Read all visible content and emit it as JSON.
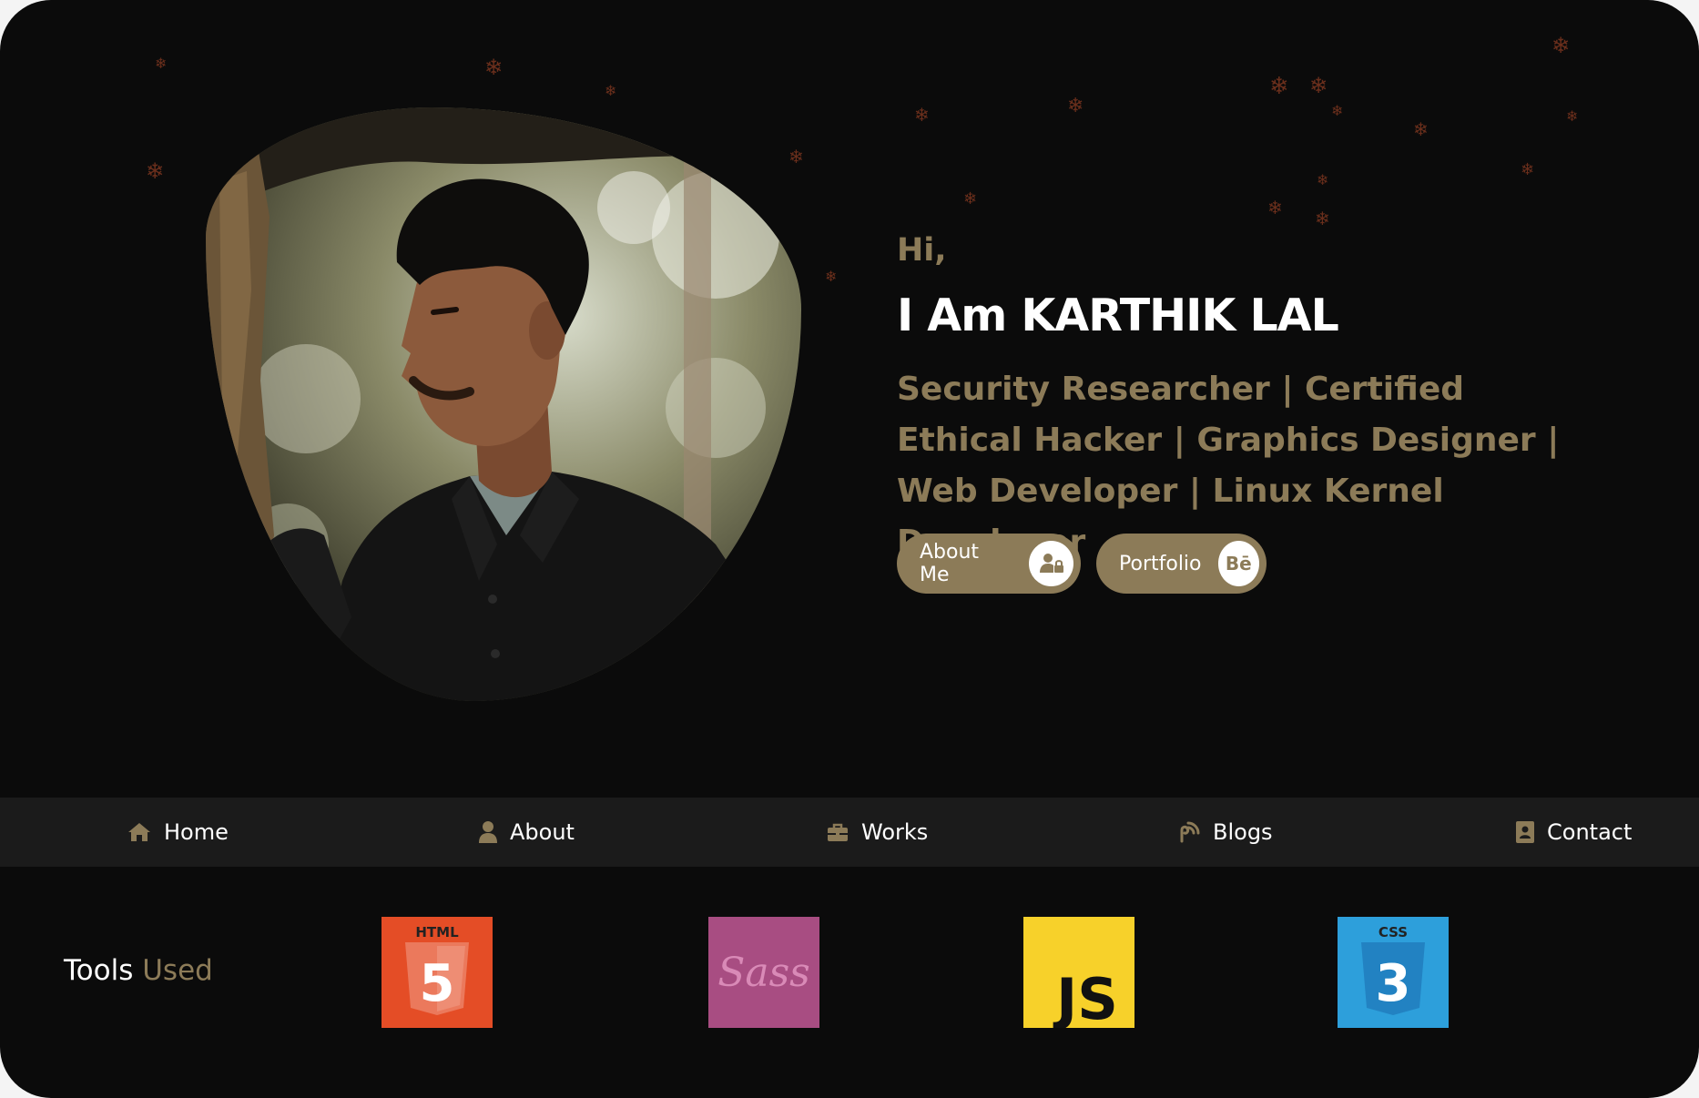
{
  "hero": {
    "greeting": "Hi,",
    "name": "I Am KARTHIK LAL",
    "roles": "Security Researcher | Certified Ethical Hacker | Graphics Designer | Web Developer | Linux Kernel Developer",
    "buttons": [
      {
        "label": "About Me",
        "icon": "user-lock-icon"
      },
      {
        "label": "Portfolio",
        "icon": "behance-icon",
        "icon_text": "Bē"
      }
    ]
  },
  "nav": {
    "items": [
      {
        "label": "Home",
        "icon": "home-icon"
      },
      {
        "label": "About",
        "icon": "user-icon"
      },
      {
        "label": "Works",
        "icon": "briefcase-icon"
      },
      {
        "label": "Blogs",
        "icon": "blog-icon"
      },
      {
        "label": "Contact",
        "icon": "address-book-icon"
      }
    ]
  },
  "tools": {
    "title_main": "Tools",
    "title_accent": "Used",
    "items": [
      {
        "name": "HTML5",
        "logo_text": "HTML",
        "digit": "5",
        "color": "#e44d26"
      },
      {
        "name": "Sass",
        "logo_text": "Sass",
        "color": "#a84d82"
      },
      {
        "name": "JavaScript",
        "logo_text": "JS",
        "color": "#f7d12a"
      },
      {
        "name": "CSS3",
        "logo_text": "CSS",
        "digit": "3",
        "color": "#2d9fdb"
      }
    ]
  },
  "colors": {
    "background": "#0b0b0b",
    "accent": "#8c7b58",
    "nav_bar": "#1b1b1b",
    "snowflake": "#6b2f1c"
  }
}
